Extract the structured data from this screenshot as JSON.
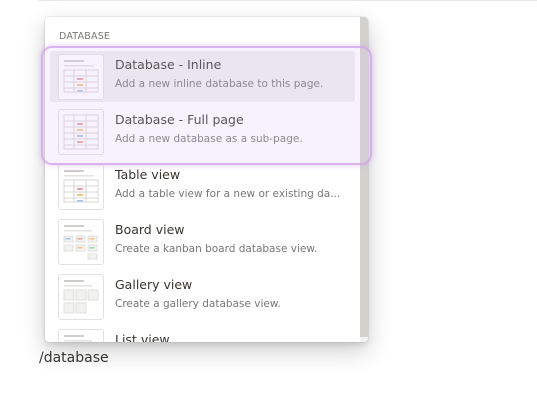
{
  "command": {
    "text": "/database"
  },
  "menu": {
    "section_header": "DATABASE",
    "items": [
      {
        "title": "Database - Inline",
        "description": "Add a new inline database to this page.",
        "icon": "inline-database-thumbnail-icon"
      },
      {
        "title": "Database - Full page",
        "description": "Add a new database as a sub-page.",
        "icon": "fullpage-database-thumbnail-icon"
      },
      {
        "title": "Table view",
        "description": "Add a table view for a new or existing da...",
        "icon": "table-view-thumbnail-icon"
      },
      {
        "title": "Board view",
        "description": "Create a kanban board database view.",
        "icon": "board-view-thumbnail-icon"
      },
      {
        "title": "Gallery view",
        "description": "Create a gallery database view.",
        "icon": "gallery-view-thumbnail-icon"
      },
      {
        "title": "List view",
        "description": "",
        "icon": "list-view-thumbnail-icon"
      }
    ]
  },
  "colors": {
    "text_primary": "#37352f",
    "text_secondary": "#787774",
    "hover_bg": "#ebebea",
    "highlight": "#d2a0eb"
  }
}
